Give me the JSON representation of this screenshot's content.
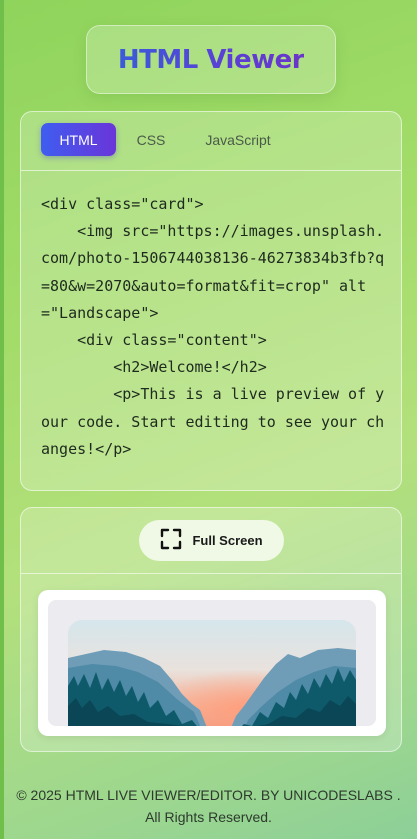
{
  "header": {
    "title": "HTML Viewer"
  },
  "tabs": [
    {
      "label": "HTML",
      "active": true
    },
    {
      "label": "CSS",
      "active": false
    },
    {
      "label": "JavaScript",
      "active": false
    }
  ],
  "editor": {
    "code": "<div class=\"card\">\n    <img src=\"https://images.unsplash.com/photo-1506744038136-46273834b3fb?q=80&w=2070&auto=format&fit=crop\" alt=\"Landscape\">\n    <div class=\"content\">\n        <h2>Welcome!</h2>\n        <p>This is a live preview of your code. Start editing to see your changes!</p>"
  },
  "preview": {
    "fullscreen_label": "Full Screen",
    "fullscreen_icon": "expand-icon",
    "image_alt": "Landscape"
  },
  "footer": {
    "text": "© 2025 HTML LIVE VIEWER/EDITOR. BY UNICODESLABS . All Rights Reserved."
  },
  "colors": {
    "accent_start": "#3f5df0",
    "accent_end": "#6a35d9",
    "background": "#a4dc6a"
  }
}
